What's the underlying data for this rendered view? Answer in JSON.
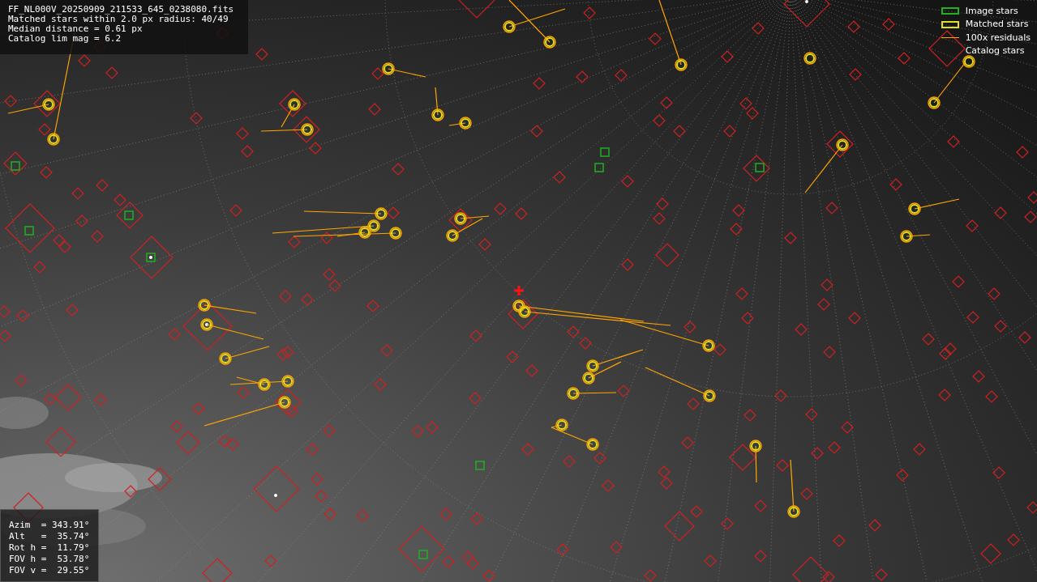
{
  "fit_info": {
    "lines": [
      "FF_NL000V_20250909_211533_645_0238080.fits",
      "Matched stars within 2.0 px radius: 40/49",
      "Median distance = 0.61 px",
      "Catalog lim mag = 6.2"
    ]
  },
  "legend": {
    "items": [
      {
        "label": "Image stars",
        "kind": "box",
        "color": "#20b020"
      },
      {
        "label": "Matched stars",
        "kind": "box",
        "color": "#e0e020"
      },
      {
        "label": "100x residuals",
        "kind": "line",
        "color": "#ffa500"
      },
      {
        "label": "Catalog stars",
        "kind": "none"
      }
    ]
  },
  "pointing": {
    "lines": [
      "Azim  = 343.91°",
      "Alt   =  35.74°",
      "Rot h =  11.79°",
      "FOV h =  53.78°",
      "FOV v =  29.55°"
    ]
  }
}
